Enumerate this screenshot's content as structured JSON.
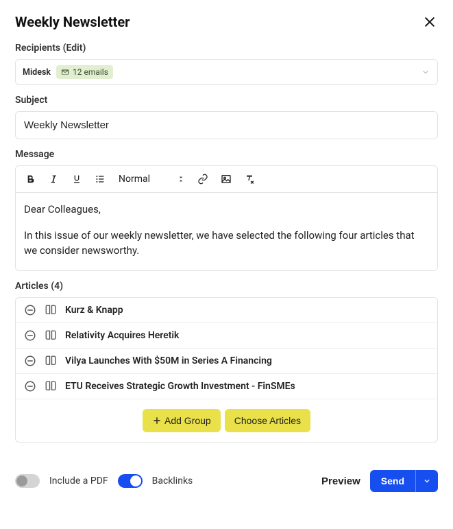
{
  "header": {
    "title": "Weekly Newsletter"
  },
  "recipients": {
    "section_label": "Recipients",
    "edit_label": "(Edit)",
    "group_name": "Midesk",
    "email_count": "12 emails"
  },
  "subject": {
    "section_label": "Subject",
    "value": "Weekly Newsletter"
  },
  "message": {
    "section_label": "Message",
    "format_label": "Normal",
    "body_line1": "Dear Colleagues,",
    "body_line2": "In this issue of our weekly newsletter, we have selected the following four articles that we consider newsworthy."
  },
  "articles": {
    "section_label": "Articles (4)",
    "items": [
      {
        "title": "Kurz & Knapp"
      },
      {
        "title": "Relativity Acquires Heretik"
      },
      {
        "title": "Vilya Launches With $50M in Series A Financing"
      },
      {
        "title": "ETU Receives Strategic Growth Investment - FinSMEs"
      }
    ],
    "add_group_label": "Add Group",
    "choose_articles_label": "Choose Articles"
  },
  "footer": {
    "include_pdf_label": "Include a PDF",
    "backlinks_label": "Backlinks",
    "preview_label": "Preview",
    "send_label": "Send"
  }
}
